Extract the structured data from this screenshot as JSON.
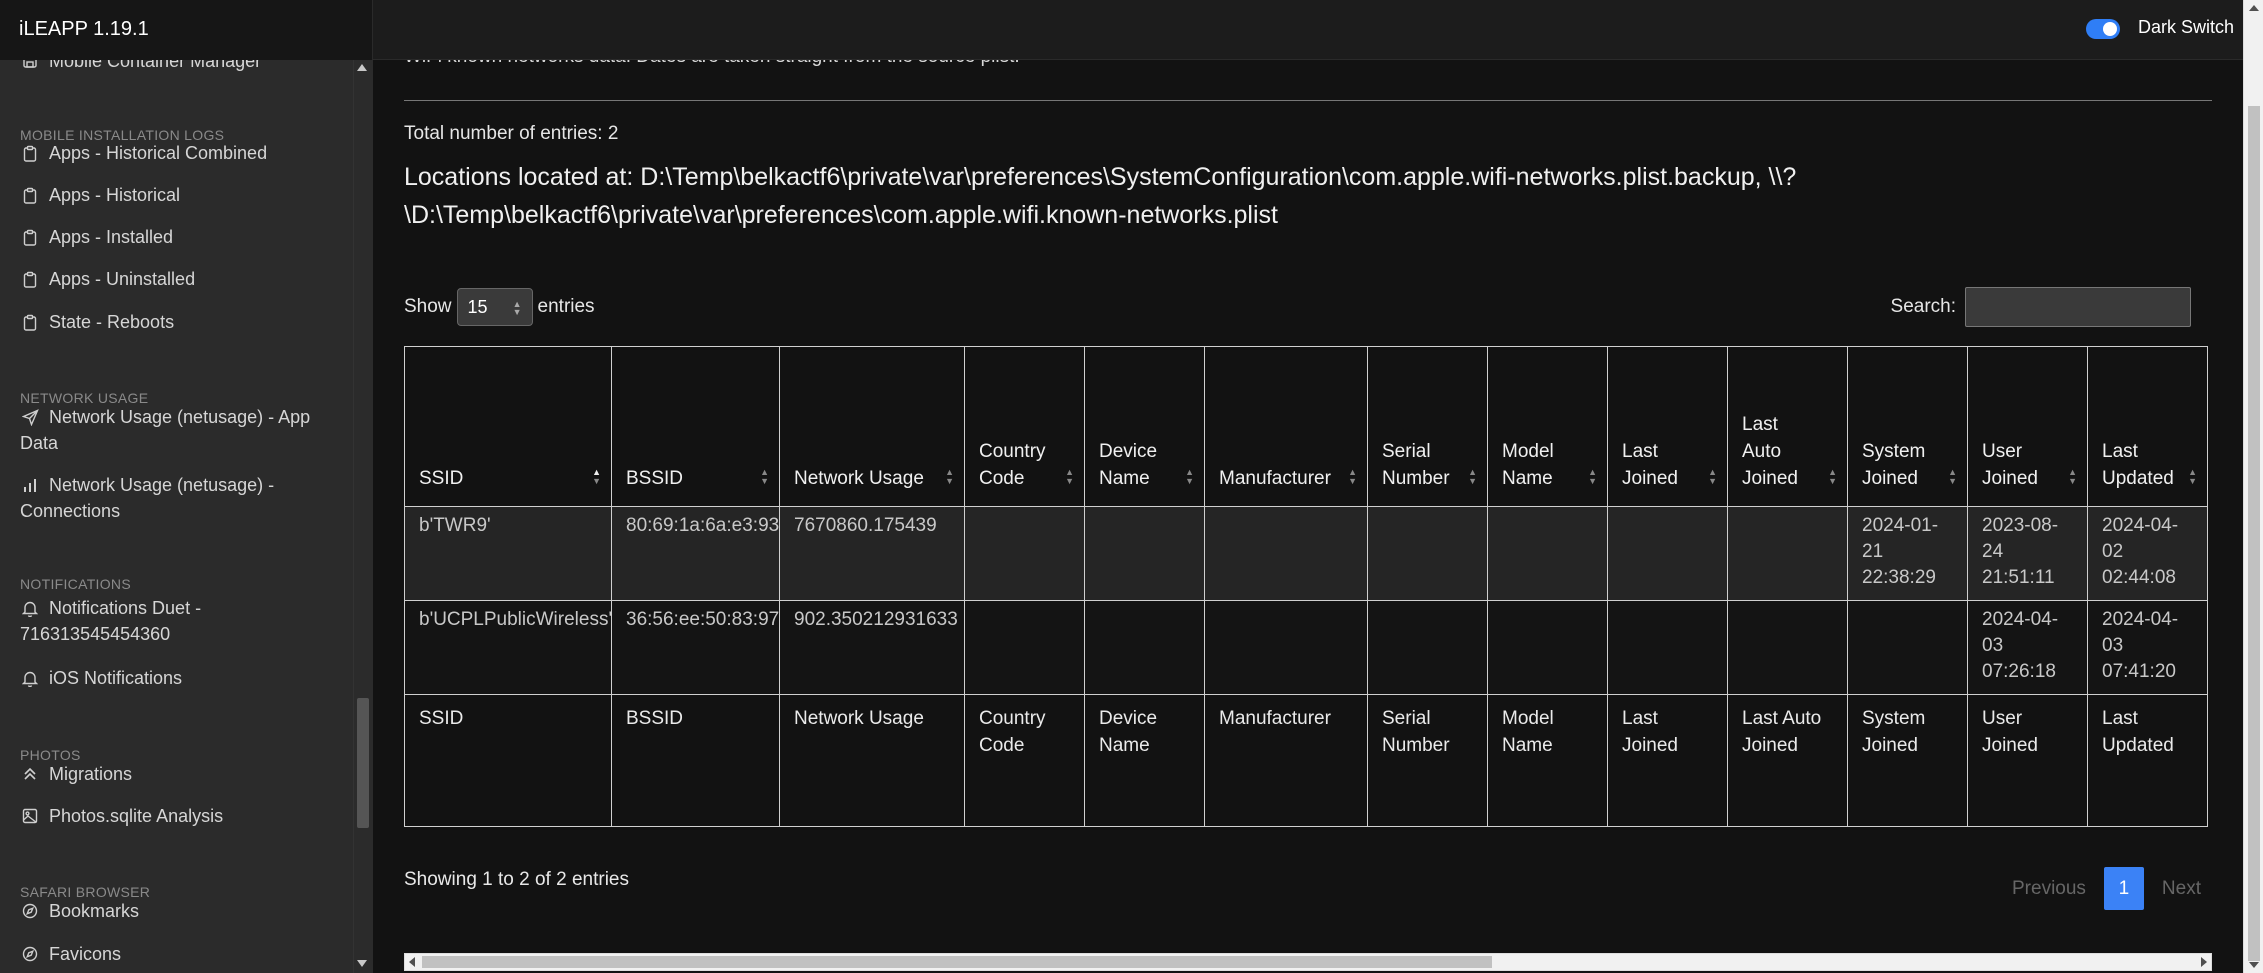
{
  "app": {
    "title": "iLEAPP 1.19.1",
    "dark_switch_label": "Dark Switch",
    "dark_switch_on": true
  },
  "sidebar": {
    "items": [
      {
        "type": "item",
        "label": "Mobile Container Manager",
        "icon": "save-icon"
      },
      {
        "type": "heading",
        "label": "MOBILE INSTALLATION LOGS"
      },
      {
        "type": "item",
        "label": "Apps - Historical Combined",
        "icon": "clipboard-icon"
      },
      {
        "type": "item",
        "label": "Apps - Historical",
        "icon": "clipboard-icon"
      },
      {
        "type": "item",
        "label": "Apps - Installed",
        "icon": "clipboard-icon"
      },
      {
        "type": "item",
        "label": "Apps - Uninstalled",
        "icon": "clipboard-icon"
      },
      {
        "type": "item",
        "label": "State - Reboots",
        "icon": "clipboard-icon"
      },
      {
        "type": "heading",
        "label": "NETWORK USAGE"
      },
      {
        "type": "item",
        "label": "Network Usage (netusage) - App Data",
        "icon": "send-icon"
      },
      {
        "type": "item",
        "label": "Network Usage (netusage) - Connections",
        "icon": "bar-chart-icon"
      },
      {
        "type": "heading",
        "label": "NOTIFICATIONS"
      },
      {
        "type": "item",
        "label": "Notifications Duet - 716313545454360",
        "icon": "bell-icon"
      },
      {
        "type": "item",
        "label": "iOS Notifications",
        "icon": "bell-icon"
      },
      {
        "type": "heading",
        "label": "PHOTOS"
      },
      {
        "type": "item",
        "label": "Migrations",
        "icon": "chevrons-up-icon"
      },
      {
        "type": "item",
        "label": "Photos.sqlite Analysis",
        "icon": "image-icon"
      },
      {
        "type": "heading",
        "label": "SAFARI BROWSER"
      },
      {
        "type": "item",
        "label": "Bookmarks",
        "icon": "compass-icon"
      },
      {
        "type": "item",
        "label": "Favicons",
        "icon": "compass-icon"
      }
    ]
  },
  "main": {
    "description": "WiFi known networks data. Dates are taken straight from the source plist.",
    "total_entries": "Total number of entries: 2",
    "locations": "Locations located at: D:\\Temp\\belkactf6\\private\\var\\preferences\\SystemConfiguration\\com.apple.wifi-networks.plist.backup, \\\\?\\D:\\Temp\\belkactf6\\private\\var\\preferences\\com.apple.wifi.known-networks.plist",
    "show_label": "Show",
    "show_value": "15",
    "entries_label": "entries",
    "search_label": "Search:",
    "search_value": "",
    "table": {
      "headers": [
        "SSID",
        "BSSID",
        "Network Usage",
        "Country Code",
        "Device Name",
        "Manufacturer",
        "Serial Number",
        "Model Name",
        "Last Joined",
        "Last Auto Joined",
        "System Joined",
        "User Joined",
        "Last Updated"
      ],
      "footers": [
        "SSID",
        "BSSID",
        "Network Usage",
        "Country Code",
        "Device Name",
        "Manufacturer",
        "Serial Number",
        "Model Name",
        "Last Joined",
        "Last Auto Joined",
        "System Joined",
        "User Joined",
        "Last Updated"
      ],
      "rows": [
        [
          "b'TWR9'",
          "80:69:1a:6a:e3:93",
          "7670860.175439",
          "",
          "",
          "",
          "",
          "",
          "",
          "",
          "2024-01-21 22:38:29",
          "2023-08-24 21:51:11",
          "2024-04-02 02:44:08"
        ],
        [
          "b'UCPLPublicWireless'",
          "36:56:ee:50:83:97",
          "902.350212931633",
          "",
          "",
          "",
          "",
          "",
          "",
          "",
          "",
          "2024-04-03 07:26:18",
          "2024-04-03 07:41:20"
        ]
      ]
    },
    "info": "Showing 1 to 2 of 2 entries",
    "pager": {
      "previous": "Previous",
      "current": "1",
      "next": "Next"
    }
  }
}
